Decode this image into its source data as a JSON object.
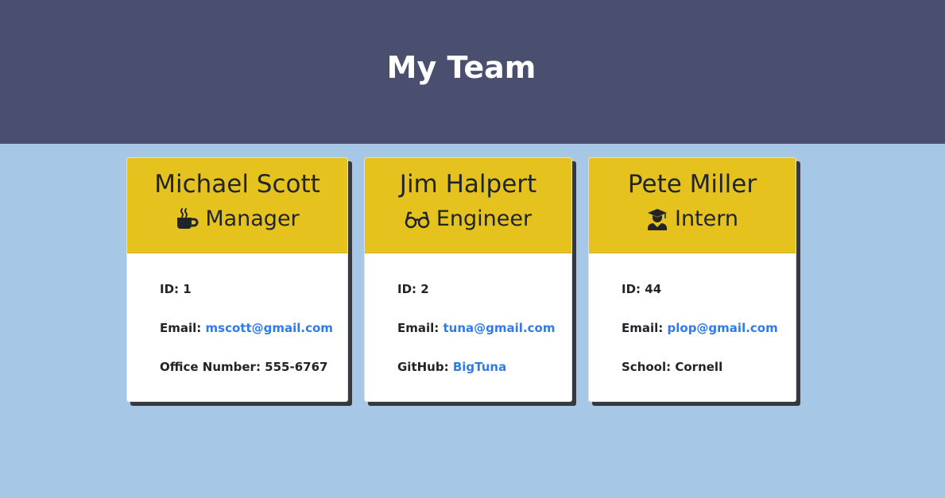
{
  "header": {
    "title": "My Team"
  },
  "cards": [
    {
      "name": "Michael Scott",
      "role": "Manager",
      "role_icon": "mug-icon",
      "id_label": "ID:",
      "id": "1",
      "email_label": "Email:",
      "email": "mscott@gmail.com",
      "extra_label": "Office Number:",
      "extra": "555-6767"
    },
    {
      "name": "Jim Halpert",
      "role": "Engineer",
      "role_icon": "glasses-icon",
      "id_label": "ID:",
      "id": "2",
      "email_label": "Email:",
      "email": "tuna@gmail.com",
      "extra_label": "GitHub:",
      "extra": "BigTuna"
    },
    {
      "name": "Pete Miller",
      "role": "Intern",
      "role_icon": "graduate-icon",
      "id_label": "ID:",
      "id": "44",
      "email_label": "Email:",
      "email": "plop@gmail.com",
      "extra_label": "School:",
      "extra": "Cornell"
    }
  ],
  "colors": {
    "header_bg": "#4b4f6f",
    "page_bg": "#a6c7e6",
    "card_head_bg": "#e6c21e",
    "link": "#2f7bea"
  }
}
